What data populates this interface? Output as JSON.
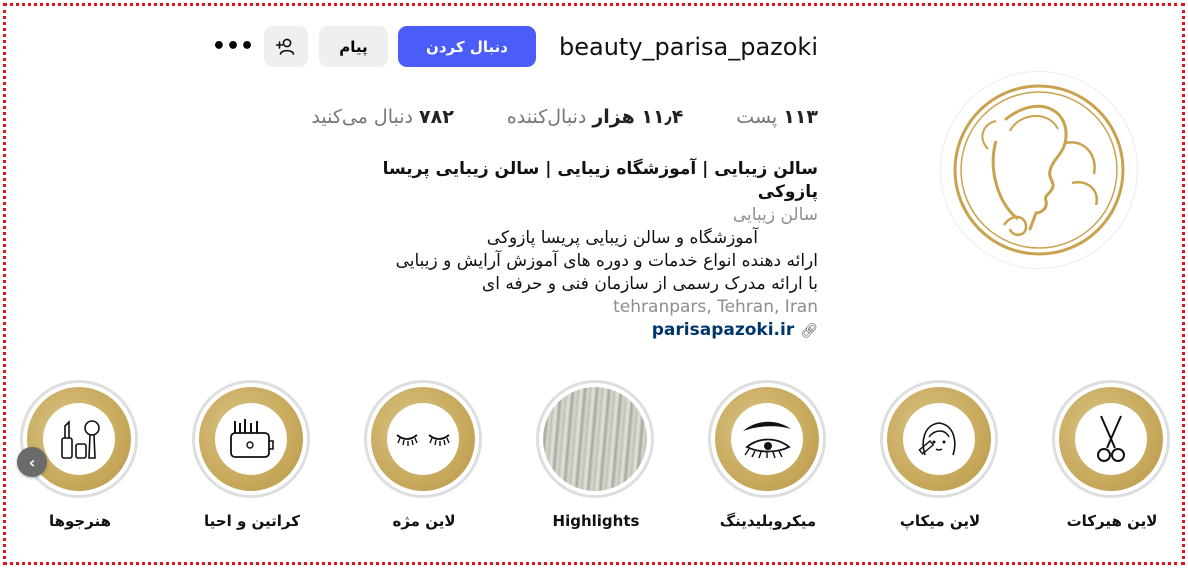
{
  "profile": {
    "username": "beauty_parisa_pazoki",
    "follow_label": "دنبال کردن",
    "message_label": "پیام",
    "suggest_icon": "add-person-icon",
    "more_label": "•••"
  },
  "stats": {
    "posts_value": "۱۱۳",
    "posts_label": "پست",
    "followers_value": "۱۱٫۴ هزار",
    "followers_label": "دنبال‌کننده",
    "following_value": "۷۸۲",
    "following_label": "دنبال می‌کنید"
  },
  "bio": {
    "name": "سالن زیبایی | آموزشگاه زیبایی | سالن زیبایی پریسا پازوکی",
    "category": "سالن زیبایی",
    "lines": [
      "آموزشگاه و سالن زیبایی پریسا پازوکی",
      "ارائه دهنده انواع خدمات و دوره های آموزش آرایش و زیبایی",
      "با ارائه مدرک رسمی از سازمان فنی و حرفه ای"
    ],
    "location": "tehranpars, Tehran, Iran",
    "link": "parisapazoki.ir",
    "link_icon": "link-icon"
  },
  "highlights": [
    {
      "label": "لاین هیرکات",
      "icon": "scissors-icon"
    },
    {
      "label": "لاین میکاپ",
      "icon": "makeup-face-icon"
    },
    {
      "label": "میکروبلیدینگ",
      "icon": "eyebrow-eye-icon"
    },
    {
      "label": "Highlights",
      "icon": "hair-photo"
    },
    {
      "label": "لاین مژه",
      "icon": "eyelashes-icon"
    },
    {
      "label": "کراتین و احیا",
      "icon": "hair-products-icon"
    },
    {
      "label": "هنرجوها",
      "icon": "cosmetics-brush-icon"
    }
  ],
  "highlight_prev_icon": "chevron-left-icon",
  "colors": {
    "follow_button": "#4a5df9",
    "gold": "#c8a95c",
    "frame": "#e0141b",
    "link": "#00376b"
  }
}
